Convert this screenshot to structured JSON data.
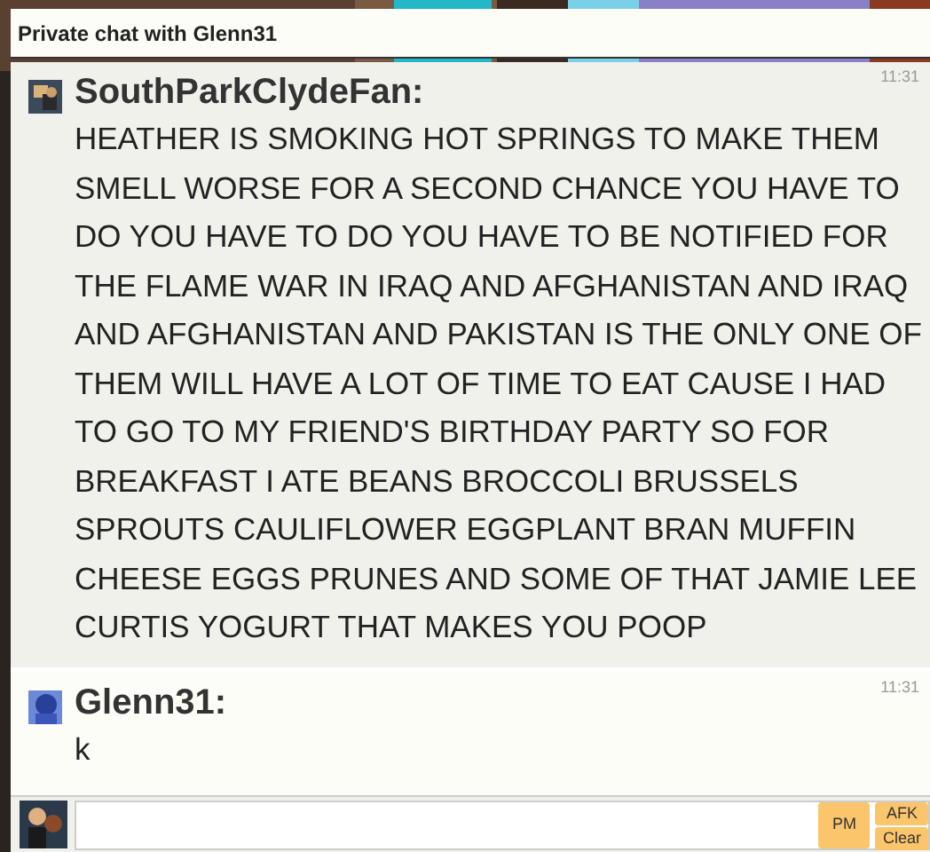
{
  "window": {
    "title": "Private chat with Glenn31"
  },
  "messages": [
    {
      "author": "SouthParkClydeFan:",
      "time": "11:31",
      "text": "HEATHER IS SMOKING HOT SPRINGS TO MAKE THEM SMELL WORSE FOR A SECOND CHANCE YOU HAVE TO DO YOU HAVE TO DO YOU HAVE TO BE NOTIFIED FOR THE FLAME WAR IN IRAQ AND AFGHANISTAN AND IRAQ AND AFGHANISTAN AND PAKISTAN IS THE ONLY ONE OF THEM WILL HAVE A LOT OF TIME TO EAT CAUSE I HAD TO GO TO MY FRIEND'S BIRTHDAY PARTY SO FOR BREAKFAST I ATE BEANS BROCCOLI BRUSSELS SPROUTS CAULIFLOWER EGGPLANT BRAN MUFFIN CHEESE EGGS PRUNES AND SOME OF THAT JAMIE LEE CURTIS YOGURT THAT MAKES YOU POOP",
      "selected": false
    },
    {
      "author": "Glenn31:",
      "time": "11:31",
      "text": "k",
      "selected": true
    }
  ],
  "composer": {
    "buttons": [
      "PM",
      "AFK",
      "Clear"
    ]
  }
}
